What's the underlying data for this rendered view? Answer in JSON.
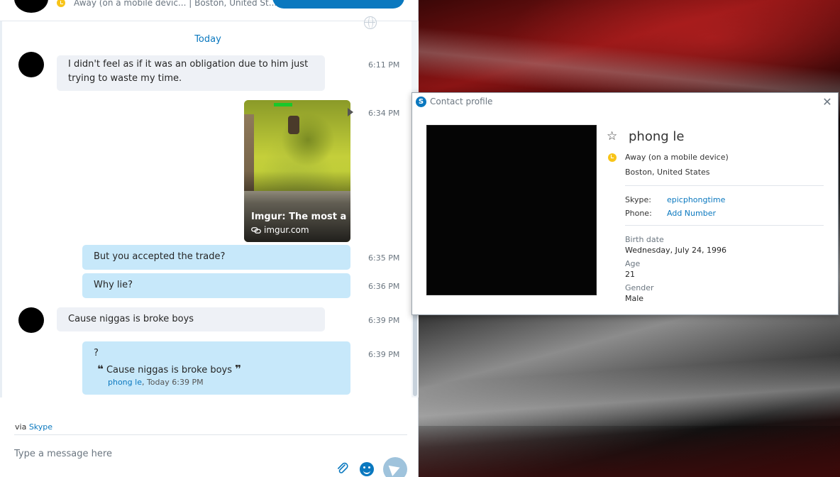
{
  "header": {
    "status_text": "Away (on a mobile devic...  |  Boston, United St..."
  },
  "conversation": {
    "date_separator": "Today",
    "messages": [
      {
        "text": "I didn't feel as if it was an obligation due to him just trying to waste my time.",
        "time": "6:11 PM"
      },
      {
        "text": "But you accepted the trade?",
        "time": "6:35 PM"
      },
      {
        "text": "Why lie?",
        "time": "6:36 PM"
      },
      {
        "text": "Cause niggas is broke boys",
        "time": "6:39 PM"
      },
      {
        "text": "?",
        "time": "6:39 PM",
        "quote_text": "Cause niggas is broke boys",
        "quote_author": "phong le",
        "quote_meta": ", Today 6:39 PM"
      }
    ],
    "link_card": {
      "title": "Imgur: The most a...",
      "domain": "imgur.com",
      "time": "6:34 PM"
    }
  },
  "footer": {
    "via_prefix": "via ",
    "via_link": "Skype",
    "input_placeholder": "Type a message here"
  },
  "profile": {
    "window_title": "Contact profile",
    "name": "phong le",
    "status": "Away (on a mobile device)",
    "location": "Boston, United States",
    "skype_label": "Skype:",
    "skype_value": "epicphongtime",
    "phone_label": "Phone:",
    "phone_value": "Add Number",
    "birth_label": "Birth date",
    "birth_value": "Wednesday, July 24, 1996",
    "age_label": "Age",
    "age_value": "21",
    "gender_label": "Gender",
    "gender_value": "Male"
  },
  "icons": {
    "skype_glyph": "S",
    "close_glyph": "✕",
    "star_glyph": "☆",
    "quote_open": "❝",
    "quote_close": "❞"
  },
  "colors": {
    "accent": "#0a78bf",
    "status_away": "#f8c418",
    "bubble_out": "#c7e8fa",
    "bubble_in": "#eef1f6"
  }
}
